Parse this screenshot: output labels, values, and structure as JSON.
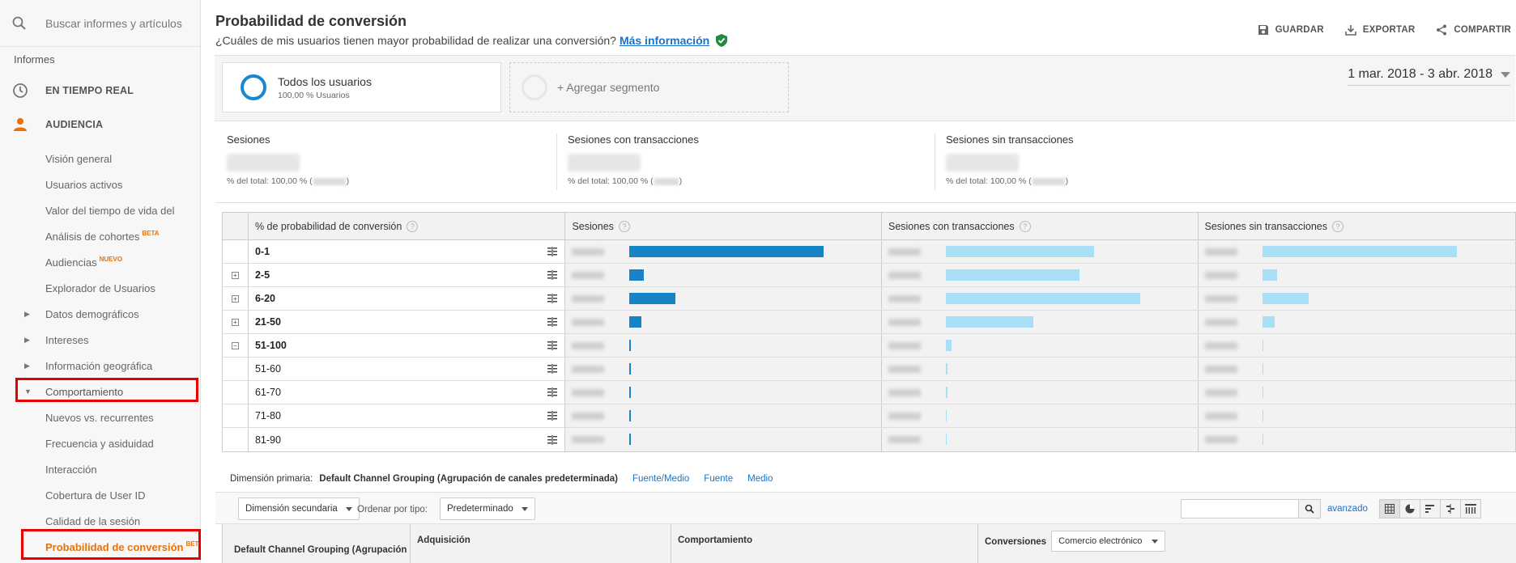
{
  "sidebar": {
    "search_placeholder": "Buscar informes y artículos",
    "section_label": "Informes",
    "realtime_label": "EN TIEMPO REAL",
    "audience_label": "AUDIENCIA",
    "items": [
      {
        "label": "Visión general",
        "expander": false
      },
      {
        "label": "Usuarios activos",
        "expander": false
      },
      {
        "label": "Valor del tiempo de vida del",
        "expander": false
      },
      {
        "label": "Análisis de cohortes",
        "badge": "BETA",
        "expander": false
      },
      {
        "label": "Audiencias",
        "badge": "NUEVO",
        "expander": false
      },
      {
        "label": "Explorador de Usuarios",
        "expander": false
      },
      {
        "label": "Datos demográficos",
        "expander": true
      },
      {
        "label": "Intereses",
        "expander": true
      },
      {
        "label": "Información geográfica",
        "expander": true
      },
      {
        "label": "Comportamiento",
        "expander": true,
        "expanded": true
      },
      {
        "label": "Nuevos vs. recurrentes",
        "expander": false
      },
      {
        "label": "Frecuencia y asiduidad",
        "expander": false
      },
      {
        "label": "Interacción",
        "expander": false
      },
      {
        "label": "Cobertura de User ID",
        "expander": false
      },
      {
        "label": "Calidad de la sesión",
        "expander": false
      },
      {
        "label": "Probabilidad de conversión",
        "badge": "BETA",
        "expander": false,
        "active": true
      }
    ],
    "accent_color": "#e8710a"
  },
  "header": {
    "title": "Probabilidad de conversión",
    "subtitle": "¿Cuáles de mis usuarios tienen mayor probabilidad de realizar una conversión?",
    "more_info": "Más información",
    "actions": {
      "save": "GUARDAR",
      "export": "EXPORTAR",
      "share": "COMPARTIR"
    }
  },
  "segments": {
    "primary_name": "Todos los usuarios",
    "primary_sub": "100,00 % Usuarios",
    "add_label": "+ Agregar segmento",
    "date_range": "1 mar. 2018 - 3 abr. 2018"
  },
  "metrics": [
    {
      "label": "Sesiones",
      "sub_prefix": "% del total: 100,00 % (",
      "sub_suffix": ")"
    },
    {
      "label": "Sesiones con transacciones",
      "sub_prefix": "% del total: 100,00 % (",
      "sub_suffix": ")"
    },
    {
      "label": "Sesiones sin transacciones",
      "sub_prefix": "% del total: 100,00 % (",
      "sub_suffix": ")"
    }
  ],
  "table": {
    "headers": [
      "% de probabilidad de conversión",
      "Sesiones",
      "Sesiones con transacciones",
      "Sesiones sin transacciones"
    ],
    "rows": [
      {
        "label": "0-1",
        "bold": true,
        "expand": "",
        "sessions_share": 0.8,
        "with_tx_share": 0.61,
        "without_tx_share": 0.8
      },
      {
        "label": "2-5",
        "bold": true,
        "expand": "+",
        "sessions_share": 0.06,
        "with_tx_share": 0.55,
        "without_tx_share": 0.06
      },
      {
        "label": "6-20",
        "bold": true,
        "expand": "+",
        "sessions_share": 0.19,
        "with_tx_share": 0.8,
        "without_tx_share": 0.19
      },
      {
        "label": "21-50",
        "bold": true,
        "expand": "+",
        "sessions_share": 0.05,
        "with_tx_share": 0.36,
        "without_tx_share": 0.05
      },
      {
        "label": "51-100",
        "bold": true,
        "expand": "−",
        "sessions_share": 0.006,
        "with_tx_share": 0.025,
        "without_tx_share": 0.005
      },
      {
        "label": "51-60",
        "bold": false,
        "expand": "",
        "sessions_share": 0.005,
        "with_tx_share": 0.008,
        "without_tx_share": 0.004
      },
      {
        "label": "61-70",
        "bold": false,
        "expand": "",
        "sessions_share": 0.005,
        "with_tx_share": 0.008,
        "without_tx_share": 0.004
      },
      {
        "label": "71-80",
        "bold": false,
        "expand": "",
        "sessions_share": 0.004,
        "with_tx_share": 0.005,
        "without_tx_share": 0.003
      },
      {
        "label": "81-90",
        "bold": false,
        "expand": "",
        "sessions_share": 0.004,
        "with_tx_share": 0.005,
        "without_tx_share": 0.003
      }
    ],
    "bar_dark": "#1784c7",
    "bar_light": "#a9dff5"
  },
  "dimension": {
    "label": "Dimensión primaria:",
    "current": "Default Channel Grouping (Agrupación de canales predeterminada)",
    "links": [
      "Fuente/Medio",
      "Fuente",
      "Medio"
    ]
  },
  "controls": {
    "secondary_dim": "Dimensión secundaria",
    "order_label": "Ordenar por tipo:",
    "order_value": "Predeterminado",
    "advanced": "avanzado"
  },
  "bottom_table": {
    "col1": "Default Channel Grouping (Agrupación de canales",
    "col2": "Adquisición",
    "col3": "Comportamiento",
    "col4": "Conversiones",
    "col4_select": "Comercio electrónico"
  }
}
